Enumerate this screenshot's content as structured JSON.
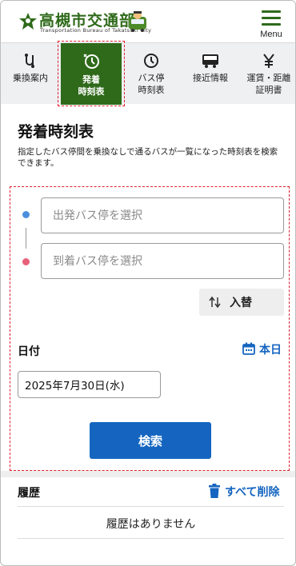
{
  "header": {
    "logo_title": "高槻市交通部",
    "logo_subtitle": "Transportation Bureau of Takatsuki City",
    "menu_label": "Menu",
    "brand_color": "#2f6a1a"
  },
  "nav": {
    "items": [
      {
        "label": "乗換案内",
        "icon": "route-icon"
      },
      {
        "label": "発着\n時刻表",
        "icon": "timetable-clock-icon",
        "active": true
      },
      {
        "label": "バス停\n時刻表",
        "icon": "clock-icon"
      },
      {
        "label": "接近情報",
        "icon": "bus-icon"
      },
      {
        "label": "運賃・距離\n証明書",
        "icon": "yen-icon"
      }
    ]
  },
  "page": {
    "title": "発着時刻表",
    "description": "指定したバス停間を乗換なしで通るバスが一覧になった時刻表を検索できます。"
  },
  "form": {
    "from_placeholder": "出発バス停を選択",
    "to_placeholder": "到着バス停を選択",
    "swap_label": "入替",
    "date_label": "日付",
    "today_label": "本日",
    "date_value": "2025年7月30日(水)",
    "search_label": "検索",
    "accent_color": "#1565c0"
  },
  "history": {
    "title": "履歴",
    "clear_label": "すべて削除",
    "empty_message": "履歴はありません"
  }
}
